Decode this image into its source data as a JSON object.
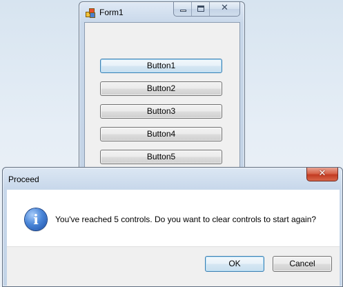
{
  "form_window": {
    "title": "Form1",
    "buttons": [
      "Button1",
      "Button2",
      "Button3",
      "Button4",
      "Button5"
    ]
  },
  "dialog": {
    "title": "Proceed",
    "message": "You've reached 5 controls. Do you want to clear controls to start again?",
    "ok_label": "OK",
    "cancel_label": "Cancel",
    "close_glyph": "✕",
    "info_glyph": "i"
  },
  "icons": {
    "form_app": "app-icon",
    "minimize": "minimize-icon",
    "maximize": "maximize-icon",
    "close": "close-icon",
    "info": "information-icon"
  },
  "colors": {
    "desktop": "#dde8f2",
    "client_area": "#f0f0f0",
    "focused_button_border": "#3c7fb1",
    "close_button_red": "#c23b22",
    "info_icon_blue": "#2d63bd"
  }
}
